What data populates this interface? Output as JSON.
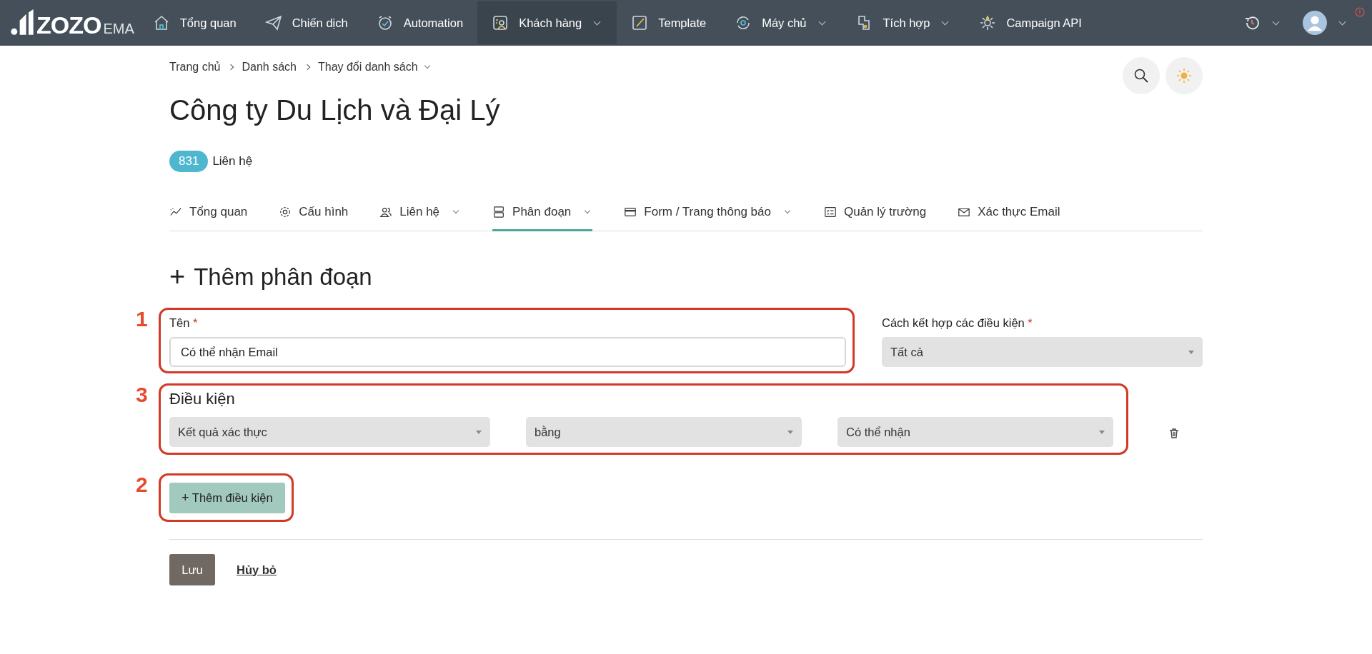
{
  "navbar": {
    "logo": {
      "brand": "ZOZO",
      "suffix": "EMA"
    },
    "items": [
      {
        "label": "Tổng quan",
        "dropdown": false,
        "selected": false
      },
      {
        "label": "Chiến dịch",
        "dropdown": false,
        "selected": false
      },
      {
        "label": "Automation",
        "dropdown": false,
        "selected": false
      },
      {
        "label": "Khách hàng",
        "dropdown": true,
        "selected": true
      },
      {
        "label": "Template",
        "dropdown": false,
        "selected": false
      },
      {
        "label": "Máy chủ",
        "dropdown": true,
        "selected": false
      },
      {
        "label": "Tích hợp",
        "dropdown": true,
        "selected": false
      },
      {
        "label": "Campaign API",
        "dropdown": false,
        "selected": false
      }
    ]
  },
  "breadcrumb": [
    {
      "label": "Trang chủ",
      "dropdown": false
    },
    {
      "label": "Danh sách",
      "dropdown": false
    },
    {
      "label": "Thay đổi danh sách",
      "dropdown": true
    }
  ],
  "page_title": "Công ty Du Lịch và Đại Lý",
  "contacts": {
    "count": "831",
    "label": "Liên hệ"
  },
  "tabs": [
    {
      "label": "Tổng quan",
      "dropdown": false,
      "selected": false
    },
    {
      "label": "Cấu hình",
      "dropdown": false,
      "selected": false
    },
    {
      "label": "Liên hệ",
      "dropdown": true,
      "selected": false
    },
    {
      "label": "Phân đoạn",
      "dropdown": true,
      "selected": true
    },
    {
      "label": "Form / Trang thông báo",
      "dropdown": true,
      "selected": false
    },
    {
      "label": "Quản lý trường",
      "dropdown": false,
      "selected": false
    },
    {
      "label": "Xác thực Email",
      "dropdown": false,
      "selected": false
    }
  ],
  "form": {
    "heading_icon": "+",
    "heading": "Thêm phân đoạn",
    "name_field": {
      "label": "Tên",
      "required_mark": "*",
      "value": "Có thể nhận Email",
      "annotation": "1"
    },
    "combine_field": {
      "label": "Cách kết hợp các điều kiện",
      "required_mark": "*",
      "value": "Tất cả"
    },
    "conditions": {
      "heading": "Điều kiện",
      "annotation": "3",
      "rows": [
        {
          "field": "Kết quả xác thực",
          "operator": "bằng",
          "value": "Có thể nhận"
        }
      ]
    },
    "add_button": {
      "icon": "+",
      "label": "Thêm điều kiện",
      "annotation": "2"
    },
    "save_button": "Lưu",
    "cancel_link": "Hủy bỏ"
  }
}
